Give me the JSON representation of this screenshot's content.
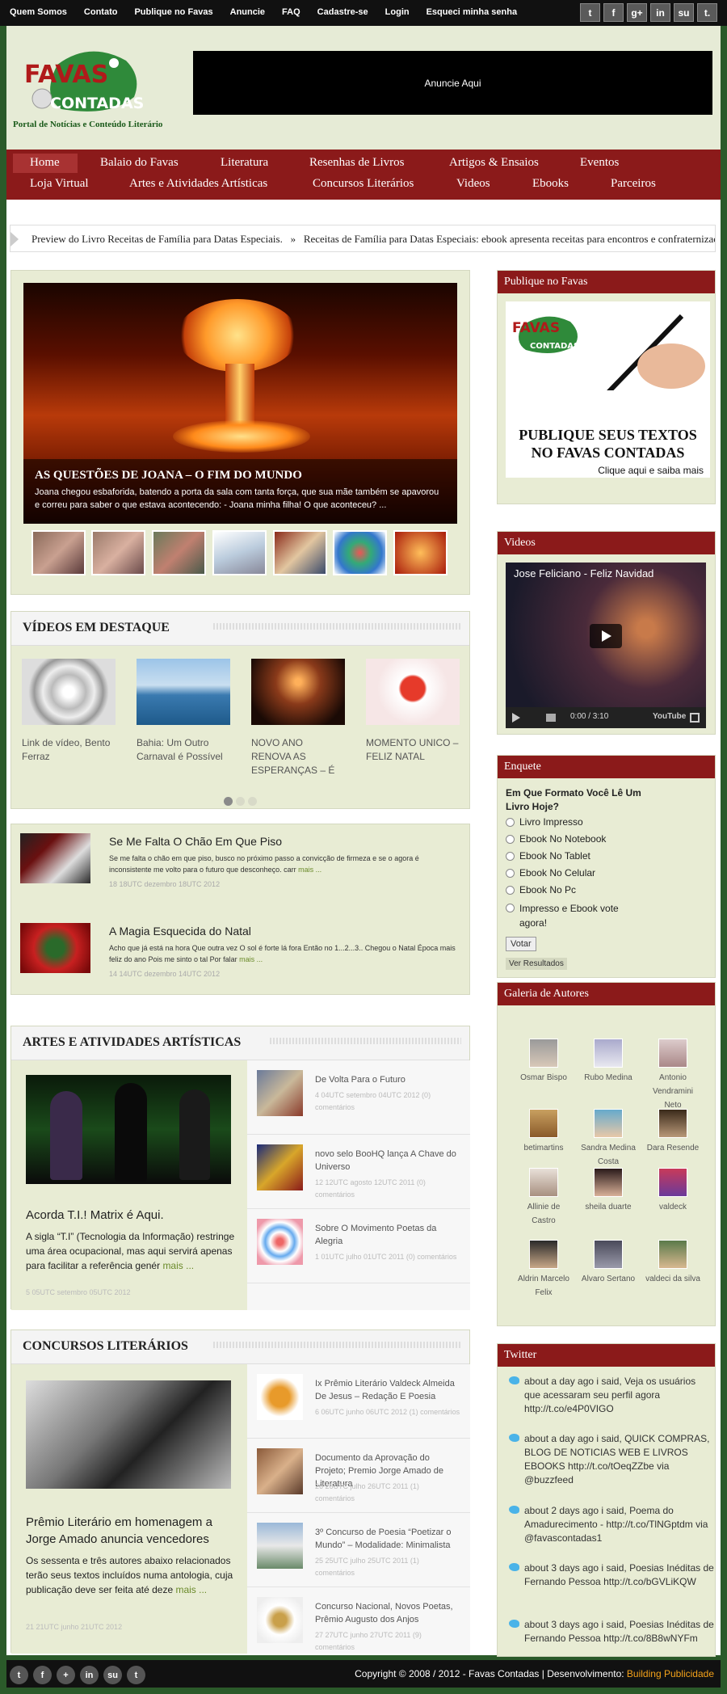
{
  "topbar": {
    "links": [
      "Quem Somos",
      "Contato",
      "Publique no Favas",
      "Anuncie",
      "FAQ",
      "Cadastre-se",
      "Login",
      "Esqueci minha senha"
    ],
    "social": [
      {
        "icon": "twitter-icon",
        "glyph": "t"
      },
      {
        "icon": "facebook-icon",
        "glyph": "f"
      },
      {
        "icon": "google-plus-icon",
        "glyph": "g+"
      },
      {
        "icon": "linkedin-icon",
        "glyph": "in"
      },
      {
        "icon": "stumbleupon-icon",
        "glyph": "su"
      },
      {
        "icon": "tumblr-icon",
        "glyph": "t."
      }
    ]
  },
  "header": {
    "logo_line1": "FAVAS",
    "logo_line2": "CONTADAS",
    "tagline": "Portal de Notícias e Conteúdo Literário",
    "ad_text": "Anuncie Aqui"
  },
  "nav": {
    "row1": [
      "Home",
      "Balaio do Favas",
      "Literatura",
      "Resenhas de Livros",
      "Artigos & Ensaios",
      "Eventos"
    ],
    "row2": [
      "Loja Virtual",
      "Artes e Atividades Artísticas",
      "Concursos Literários",
      "Videos",
      "Ebooks",
      "Parceiros"
    ]
  },
  "ticker": {
    "item1": "Preview do Livro Receitas de Família para Datas Especiais.",
    "separator": "»",
    "item2": "Receitas de Família para Datas Especiais: ebook apresenta receitas para encontros e confraternizações"
  },
  "slider": {
    "title": "AS QUESTÕES DE JOANA – O FIM DO MUNDO",
    "text": "Joana chegou esbaforida, batendo a porta da sala com tanta força, que sua mãe também se apavorou e correu para saber o que estava acontecendo: - Joana minha filha! O que aconteceu? ..."
  },
  "videos_section": {
    "heading": "VÍDEOS EM DESTAQUE",
    "items": [
      "Link de vídeo, Bento Ferraz",
      "Bahia: Um Outro Carnaval é Possível",
      "NOVO ANO RENOVA AS ESPERANÇAS – É PRECISO SABER",
      "MOMENTO UNICO – FELIZ NATAL"
    ]
  },
  "posts": [
    {
      "title": "Se Me Falta O Chão Em Que Piso",
      "text": "Se me falta o chão em que piso, busco no próximo passo a convicção de firmeza e se o agora é inconsistente me volto para o futuro que desconheço. carr",
      "more": "mais ...",
      "date": "18 18UTC dezembro 18UTC 2012"
    },
    {
      "title": "A Magia Esquecida do Natal",
      "text": "Acho que já está na hora Que outra vez O sol é forte lá fora Então no 1...2...3.. Chegou o Natal Época mais feliz do ano Pois me sinto o tal Por falar",
      "more": "mais ...",
      "date": "14 14UTC dezembro 14UTC 2012"
    }
  ],
  "artes": {
    "heading": "ARTES E ATIVIDADES ARTÍSTICAS",
    "main_title": "Acorda T.I.! Matrix é Aqui.",
    "main_text": "A sigla “T.I” (Tecnologia da Informação) restringe uma área ocupacional, mas aqui servirá apenas para facilitar a referência genér",
    "main_more": "mais ...",
    "main_date": "5 05UTC setembro 05UTC 2012",
    "side": [
      {
        "title": "De Volta Para o Futuro",
        "meta": "4 04UTC setembro 04UTC 2012 (0) comentários"
      },
      {
        "title": "novo selo BooHQ lança A Chave do Universo",
        "meta": "12 12UTC agosto 12UTC 2011 (0) comentários"
      },
      {
        "title": "Sobre O Movimento Poetas da Alegria",
        "meta": "1 01UTC julho 01UTC 2011 (0) comentários"
      }
    ]
  },
  "concursos": {
    "heading": "CONCURSOS LITERÁRIOS",
    "main_title": "Prêmio Literário em homenagem a Jorge Amado anuncia vencedores",
    "main_text": "Os sessenta e três autores abaixo relacionados terão seus textos incluídos numa antologia, cuja publicação deve ser feita até deze",
    "main_more": "mais ...",
    "main_date": "21 21UTC junho 21UTC 2012",
    "side": [
      {
        "title": "Ix Prêmio Literário Valdeck Almeida De Jesus – Redação E Poesia",
        "meta": "6 06UTC junho 06UTC 2012 (1) comentários"
      },
      {
        "title": "Documento da Aprovação do Projeto; Premio Jorge Amado de Literatura",
        "meta": "26 26UTC julho 26UTC 2011 (1) comentários"
      },
      {
        "title": "3º Concurso de Poesia “Poetizar o Mundo” – Modalidade: Minimalista",
        "meta": "25 25UTC julho 25UTC 2011 (1) comentários"
      },
      {
        "title": "Concurso Nacional, Novos Poetas, Prêmio Augusto dos Anjos",
        "meta": "27 27UTC junho 27UTC 2011 (9) comentários"
      }
    ]
  },
  "sidebar": {
    "publique": {
      "heading": "Publique no Favas",
      "line1": "PUBLIQUE SEUS TEXTOS",
      "line2": "NO FAVAS CONTADAS",
      "line3": "Clique aqui e saiba mais"
    },
    "videos": {
      "heading": "Videos",
      "title": "Jose Feliciano - Feliz Navidad",
      "time": "0:00 / 3:10",
      "brand": "YouTube"
    },
    "enquete": {
      "heading": "Enquete",
      "question": "Em Que Formato Você Lê Um Livro Hoje?",
      "options": [
        "Livro Impresso",
        "Ebook No Notebook",
        "Ebook No Tablet",
        "Ebook No Celular",
        "Ebook No Pc",
        "Impresso e Ebook vote agora!"
      ],
      "vote": "Votar",
      "results": "Ver Resultados"
    },
    "galeria": {
      "heading": "Galeria de Autores",
      "authors": [
        "Osmar Bispo",
        "Rubo Medina",
        "Antonio Vendramini Neto",
        "betimartins",
        "Sandra Medina Costa",
        "Dara Resende",
        "Allinie de Castro",
        "sheila duarte",
        "valdeck",
        "Aldrin Marcelo Felix",
        "Alvaro Sertano",
        "valdeci da silva"
      ]
    },
    "twitter": {
      "heading": "Twitter",
      "tweets": [
        "about a day ago i said, Veja os usuários que acessaram seu perfil agora http://t.co/e4P0VIGO",
        "about a day ago i said, QUICK COMPRAS, BLOG DE NOTICIAS WEB E LIVROS EBOOKS http://t.co/tOeqZZbe via @buzzfeed",
        "about 2 days ago i said, Poema do Amadurecimento - http://t.co/TlNGptdm via @favascontadas1",
        "about 3 days ago i said, Poesias Inéditas de Fernando Pessoa http://t.co/bGVLiKQW",
        "about 3 days ago i said, Poesias Inéditas de Fernando Pessoa http://t.co/8B8wNYFm"
      ]
    }
  },
  "footer": {
    "social": [
      {
        "icon": "twitter-icon",
        "glyph": "t"
      },
      {
        "icon": "facebook-icon",
        "glyph": "f"
      },
      {
        "icon": "google-plus-icon",
        "glyph": "+"
      },
      {
        "icon": "linkedin-icon",
        "glyph": "in"
      },
      {
        "icon": "stumbleupon-icon",
        "glyph": "su"
      },
      {
        "icon": "tumblr-icon",
        "glyph": "t"
      }
    ],
    "copyright": "Copyright © 2008 / 2012 - Favas Contadas | Desenvolvimento: ",
    "builder": "Building Publicidade"
  },
  "colors": {
    "nav": "#8b1a1a",
    "panel": "#e8ecd4",
    "accent_link": "#f4a21a",
    "brand_green": "#1a5a1a"
  }
}
